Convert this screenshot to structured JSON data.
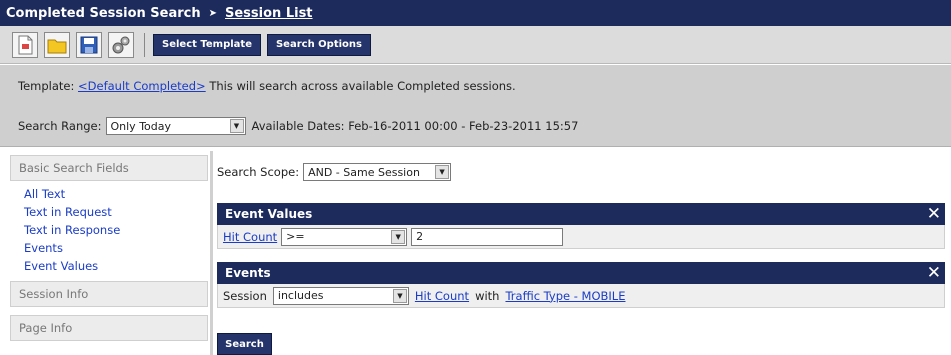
{
  "header": {
    "title": "Completed Session Search",
    "separator": "➤",
    "crumb": "Session List"
  },
  "toolbar": {
    "icons": [
      "new-document-icon",
      "open-folder-icon",
      "save-disk-icon",
      "settings-gears-icon"
    ],
    "select_template_label": "Select Template",
    "search_options_label": "Search Options"
  },
  "info": {
    "template_label": "Template:",
    "template_link": "<Default Completed>",
    "template_desc": "This will search across available Completed sessions.",
    "range_label": "Search Range:",
    "range_value": "Only Today",
    "dates_text": "Available Dates: Feb-16-2011 00:00 - Feb-23-2011 15:57"
  },
  "sidebar": {
    "basic_heading": "Basic Search Fields",
    "items": [
      "All Text",
      "Text in Request",
      "Text in Response",
      "Events",
      "Event Values"
    ],
    "session_info": "Session Info",
    "page_info": "Page Info"
  },
  "main": {
    "scope_label": "Search Scope:",
    "scope_value": "AND - Same Session",
    "event_values": {
      "title": "Event Values",
      "close": "✕",
      "field_link": "Hit Count",
      "operator": ">=",
      "value": "2"
    },
    "events": {
      "title": "Events",
      "close": "✕",
      "label": "Session",
      "operator": "includes",
      "field_link": "Hit Count",
      "with_text": "with",
      "event_link": "Traffic Type - MOBILE"
    },
    "search_button": "Search"
  },
  "colors": {
    "header_bg": "#1c2a5c",
    "button_bg": "#25346a",
    "link": "#1a3cc8",
    "panel_bg": "#cfcfcf"
  }
}
